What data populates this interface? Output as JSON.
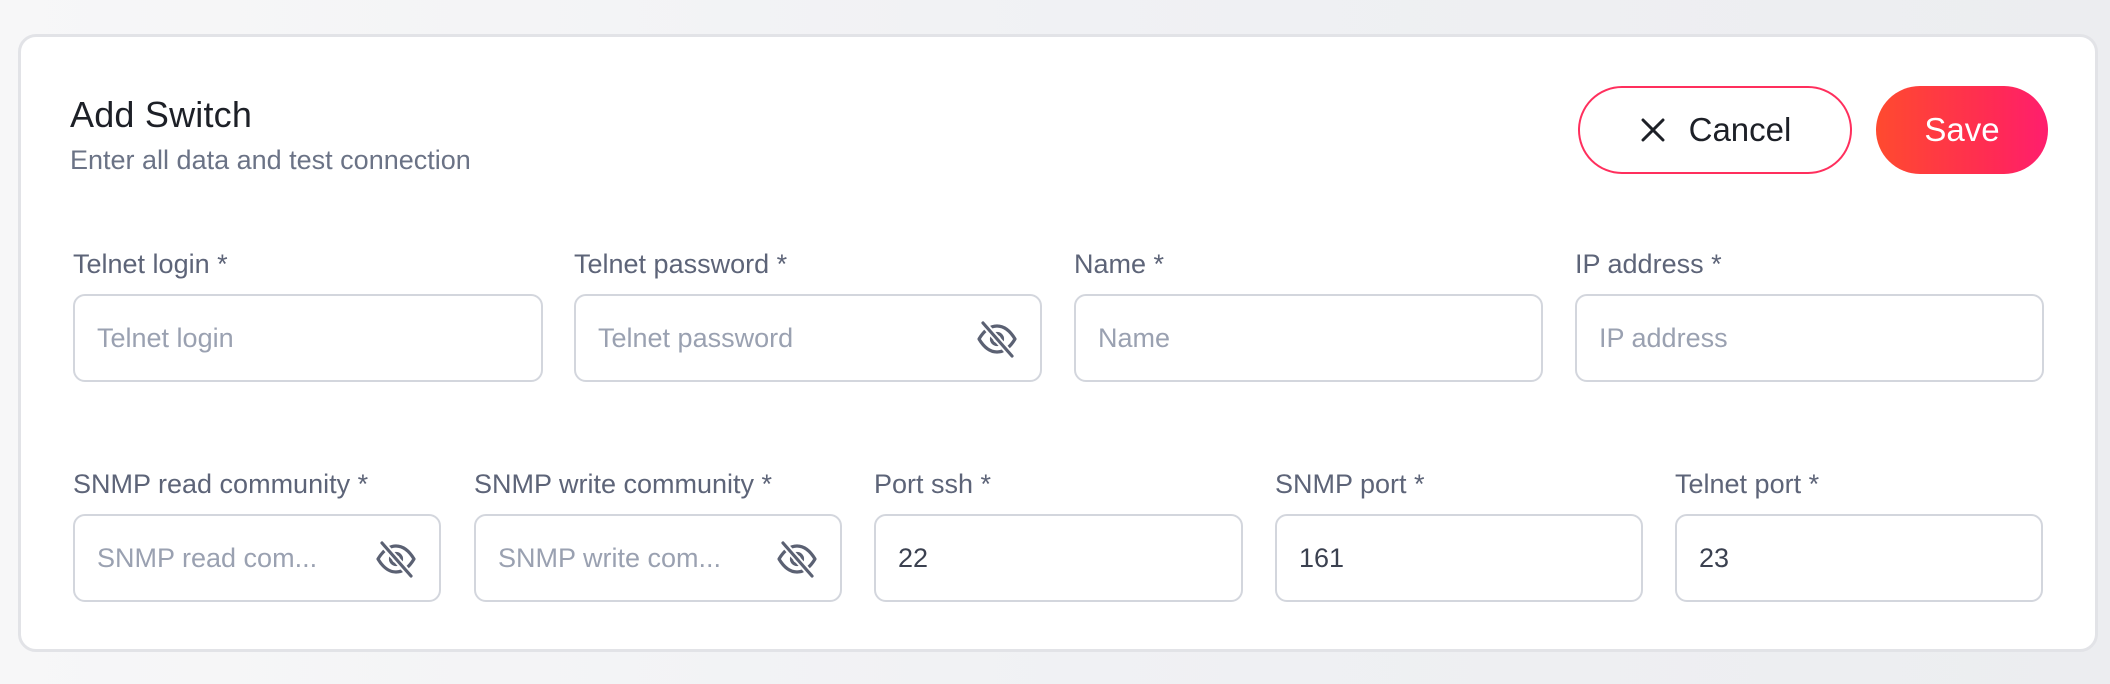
{
  "header": {
    "title": "Add Switch",
    "subtitle": "Enter all data and test connection"
  },
  "actions": {
    "cancel_label": "Cancel",
    "save_label": "Save",
    "cancel_icon": "close-icon",
    "accent_color": "#ff2f5d"
  },
  "fields": {
    "telnet_login": {
      "label": "Telnet login *",
      "placeholder": "Telnet login",
      "value": ""
    },
    "telnet_password": {
      "label": "Telnet password *",
      "placeholder": "Telnet password",
      "value": "",
      "icon": "eye-off-icon"
    },
    "name": {
      "label": "Name *",
      "placeholder": "Name",
      "value": ""
    },
    "ip_address": {
      "label": "IP address *",
      "placeholder": "IP address",
      "value": ""
    },
    "snmp_read": {
      "label": "SNMP read community *",
      "placeholder": "SNMP read com...",
      "value": "",
      "icon": "eye-off-icon"
    },
    "snmp_write": {
      "label": "SNMP write community *",
      "placeholder": "SNMP write com...",
      "value": "",
      "icon": "eye-off-icon"
    },
    "port_ssh": {
      "label": "Port ssh *",
      "placeholder": "",
      "value": "22"
    },
    "snmp_port": {
      "label": "SNMP port *",
      "placeholder": "",
      "value": "161"
    },
    "telnet_port": {
      "label": "Telnet port *",
      "placeholder": "",
      "value": "23"
    }
  }
}
